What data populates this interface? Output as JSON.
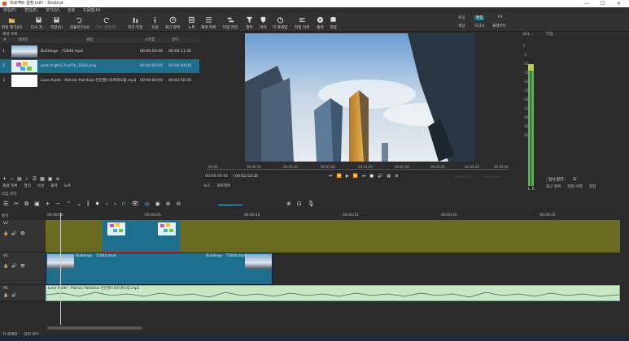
{
  "window": {
    "title": "프로젝트 설정.mlt* - Shotcut",
    "minimize": "—",
    "maximize": "☐",
    "close": "✕"
  },
  "menu": [
    "파일(F)",
    "편집(E)",
    "보기(V)",
    "설정",
    "도움말(H)"
  ],
  "toolbar": {
    "left": [
      "파일 열기(O)",
      "다시 저...",
      "저장(S)",
      "되돌리기(U)",
      "다시 실행(R)",
      "피크 측정",
      "속성",
      "최근 항목",
      "노트",
      "재생 목록",
      "타임 라인",
      "필터",
      "마커",
      "키 프레임",
      "작업 이력",
      "출력",
      "작업"
    ],
    "layouts_top": [
      "로깅",
      "편집",
      "FX"
    ],
    "layouts_bottom": [
      "색상",
      "오디오",
      "플레이어"
    ]
  },
  "playlist": {
    "title": "재생 목록",
    "columns": [
      "#",
      "섬네일",
      "클립",
      "시작점",
      "길이"
    ],
    "rows": [
      {
        "num": "1",
        "clip": "Buildings - 71844.mp4",
        "in": "00:00:00:00",
        "dur": "00:00:11:30"
      },
      {
        "num": "2",
        "clip": "post-it-gb517cef7b_1920.png",
        "in": "00:00:00:00",
        "dur": "00:00:04:00"
      },
      {
        "num": "3",
        "clip": "Love Aside - Patrick Patrikios-진진행스타트와오컴.mp3",
        "in": "00:00:00:00",
        "dur": "00:02:50:35"
      }
    ],
    "tabs": [
      "재생 목록",
      "필터",
      "속성",
      "출력",
      "노트"
    ]
  },
  "player": {
    "ruler_ticks": [
      "00:00",
      "00:00:20",
      "00:00:40",
      "00:01:00",
      "00:01:20",
      "00:01:40",
      "00:02:00",
      "00:02:20",
      "00:02:40"
    ],
    "current_time": "00:00:00:44",
    "total_time": "/ 00:02:50:35",
    "in_point": "--:--:--:-- /",
    "out_point": "--:--:--:--",
    "tabs": [
      "소스",
      "프로젝트"
    ]
  },
  "audiometer": {
    "title": "오디...",
    "ticks": [
      "0",
      "-5",
      "-10",
      "-15",
      "-20",
      "-25",
      "-30",
      "-35",
      "-40",
      "-45",
      "-50"
    ],
    "lr": [
      "L",
      "R"
    ]
  },
  "jobs": {
    "title": "작업",
    "pause_label": "일시 정지",
    "tabs": [
      "최근 항목",
      "작업 이력",
      "작업"
    ]
  },
  "timeline": {
    "title": "타임 라인",
    "output_label": "출력",
    "ruler_ticks": [
      "00:00:00",
      "00:00:05",
      "00:00:10",
      "00:00:15",
      "00:00:20",
      "00:00:25"
    ],
    "tracks": [
      {
        "name": "V2",
        "clips": []
      },
      {
        "name": "V1",
        "clips": [
          "Buildings - 71844.mp4",
          "Buildings - 71844.mp4"
        ]
      },
      {
        "name": "A1",
        "clips": [
          "Love Aside - Patrick Patrikios-진진행스타트와오컴.mp3"
        ]
      }
    ],
    "bottom_tabs": [
      "키 프레임",
      "타임 라인"
    ]
  },
  "colors": {
    "accent": "#1f6e8c",
    "v2_bg": "#6b6a21",
    "v1_clip": "#1e6f8d",
    "audio_clip": "#c8e8c4",
    "meter_green": "#3fc63a"
  }
}
